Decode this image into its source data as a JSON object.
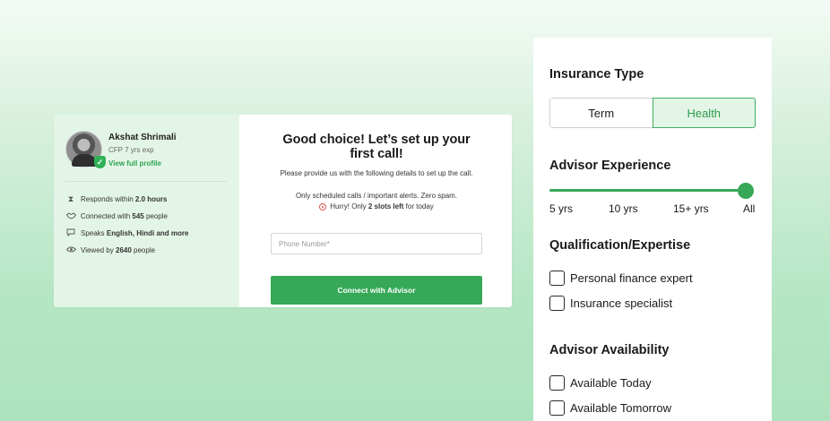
{
  "call_card": {
    "advisor": {
      "name": "Akshat Shrimali",
      "meta": "CFP 7 yrs exp",
      "view_profile": "View full profile"
    },
    "stats": [
      {
        "icon": "hourglass-icon",
        "prefix": "Responds within ",
        "bold": "2.0 hours",
        "suffix": ""
      },
      {
        "icon": "handshake-icon",
        "prefix": "Connected with ",
        "bold": "545",
        "suffix": " people"
      },
      {
        "icon": "chat-bubble-icon",
        "prefix": "Speaks ",
        "bold": "English, Hindi and more",
        "suffix": ""
      },
      {
        "icon": "eye-icon",
        "prefix": "Viewed by ",
        "bold": "2640",
        "suffix": " people"
      }
    ],
    "form": {
      "title": "Good choice! Let’s set up your first call!",
      "subtitle": "Please provide us with the following details to set up the call.",
      "note": "Only scheduled calls / important alerts. Zero spam.",
      "hurry_prefix": "Hurry! Only ",
      "hurry_bold": "2 slots left",
      "hurry_suffix": " for today",
      "phone_placeholder": "Phone Number*",
      "connect_label": "Connect with Advisor"
    }
  },
  "filters": {
    "insurance_type": {
      "heading": "Insurance Type",
      "options": [
        "Term",
        "Health"
      ],
      "selected": "Health"
    },
    "experience": {
      "heading": "Advisor Experience",
      "labels": [
        "5 yrs",
        "10 yrs",
        "15+ yrs",
        "All"
      ],
      "selected": "All"
    },
    "qualification": {
      "heading": "Qualification/Expertise",
      "options": [
        "Personal finance expert",
        "Insurance specialist"
      ]
    },
    "availability": {
      "heading": "Advisor Availability",
      "options": [
        "Available Today",
        "Available Tomorrow"
      ]
    }
  },
  "colors": {
    "accent": "#36a857",
    "accent_text": "#2fa350",
    "profile_bg": "#e3f5e7",
    "alert": "#e25353"
  }
}
